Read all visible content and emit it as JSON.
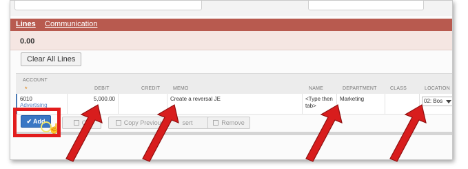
{
  "tabs": [
    {
      "label": "Lines"
    },
    {
      "label": "Communication"
    }
  ],
  "amount": "0.00",
  "clear_all_label": "Clear All Lines",
  "columns": {
    "account": "ACCOUNT",
    "account_required": "*",
    "debit": "DEBIT",
    "credit": "CREDIT",
    "memo": "MEMO",
    "name": "NAME",
    "department": "DEPARTMENT",
    "class": "CLASS",
    "location": "LOCATION"
  },
  "row": {
    "account_number": "6010",
    "account_name": "Advertising",
    "debit": "5,000.00",
    "credit": "",
    "memo": "Create a reversal JE",
    "name_placeholder": "<Type then tab>",
    "department": "Marketing",
    "class": "",
    "location": "02: Bos"
  },
  "actions": {
    "add": "Add",
    "cancel": "Ca",
    "copy_previous": "Copy Previous",
    "insert": "sert",
    "remove": "Remove"
  },
  "colors": {
    "tab_bar": "#b85a4f",
    "add_button": "#3a77c4",
    "highlight": "#e21c1c",
    "arrow": "#d81d1d"
  }
}
